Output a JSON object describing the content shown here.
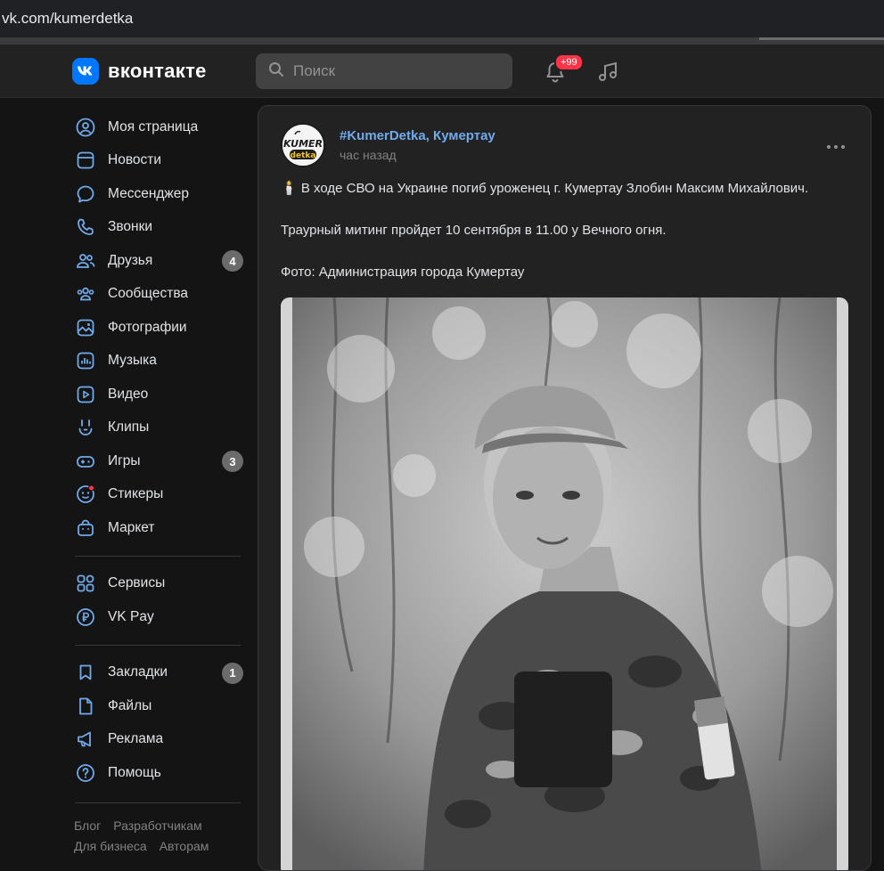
{
  "browser": {
    "url": "vk.com/kumerdetka"
  },
  "header": {
    "logo_text": "вконтакте",
    "search_placeholder": "Поиск",
    "notifications_badge": "+99"
  },
  "sidebar": {
    "group1": [
      {
        "label": "Моя страница",
        "icon": "user-circle-icon"
      },
      {
        "label": "Новости",
        "icon": "news-icon"
      },
      {
        "label": "Мессенджер",
        "icon": "message-icon"
      },
      {
        "label": "Звонки",
        "icon": "phone-icon"
      },
      {
        "label": "Друзья",
        "icon": "friends-icon",
        "badge": "4"
      },
      {
        "label": "Сообщества",
        "icon": "communities-icon"
      },
      {
        "label": "Фотографии",
        "icon": "photos-icon"
      },
      {
        "label": "Музыка",
        "icon": "music-icon"
      },
      {
        "label": "Видео",
        "icon": "video-icon"
      },
      {
        "label": "Клипы",
        "icon": "clips-icon"
      },
      {
        "label": "Игры",
        "icon": "games-icon",
        "badge": "3"
      },
      {
        "label": "Стикеры",
        "icon": "stickers-icon"
      },
      {
        "label": "Маркет",
        "icon": "market-icon"
      }
    ],
    "group2": [
      {
        "label": "Сервисы",
        "icon": "services-icon"
      },
      {
        "label": "VK Pay",
        "icon": "vkpay-icon"
      }
    ],
    "group3": [
      {
        "label": "Закладки",
        "icon": "bookmark-icon",
        "badge": "1"
      },
      {
        "label": "Файлы",
        "icon": "file-icon"
      },
      {
        "label": "Реклама",
        "icon": "megaphone-icon"
      },
      {
        "label": "Помощь",
        "icon": "help-icon"
      }
    ],
    "footer": [
      "Блог",
      "Разработчикам",
      "Для бизнеса",
      "Авторам"
    ]
  },
  "post": {
    "avatar_text": "KUMER detka",
    "author": "#KumerDetka, Кумертау",
    "time": "час назад",
    "paragraphs": [
      "🕯️ В ходе СВО на Украине погиб уроженец г. Кумертау Злобин Максим Михайлович.",
      "Траурный митинг пройдет 10 сентября в 11.00 у Вечного огня.",
      "Фото: Администрация города Кумертау"
    ]
  },
  "colors": {
    "accent": "#71aaeb",
    "brand": "#0077ff",
    "badge_red": "#ff3347"
  }
}
